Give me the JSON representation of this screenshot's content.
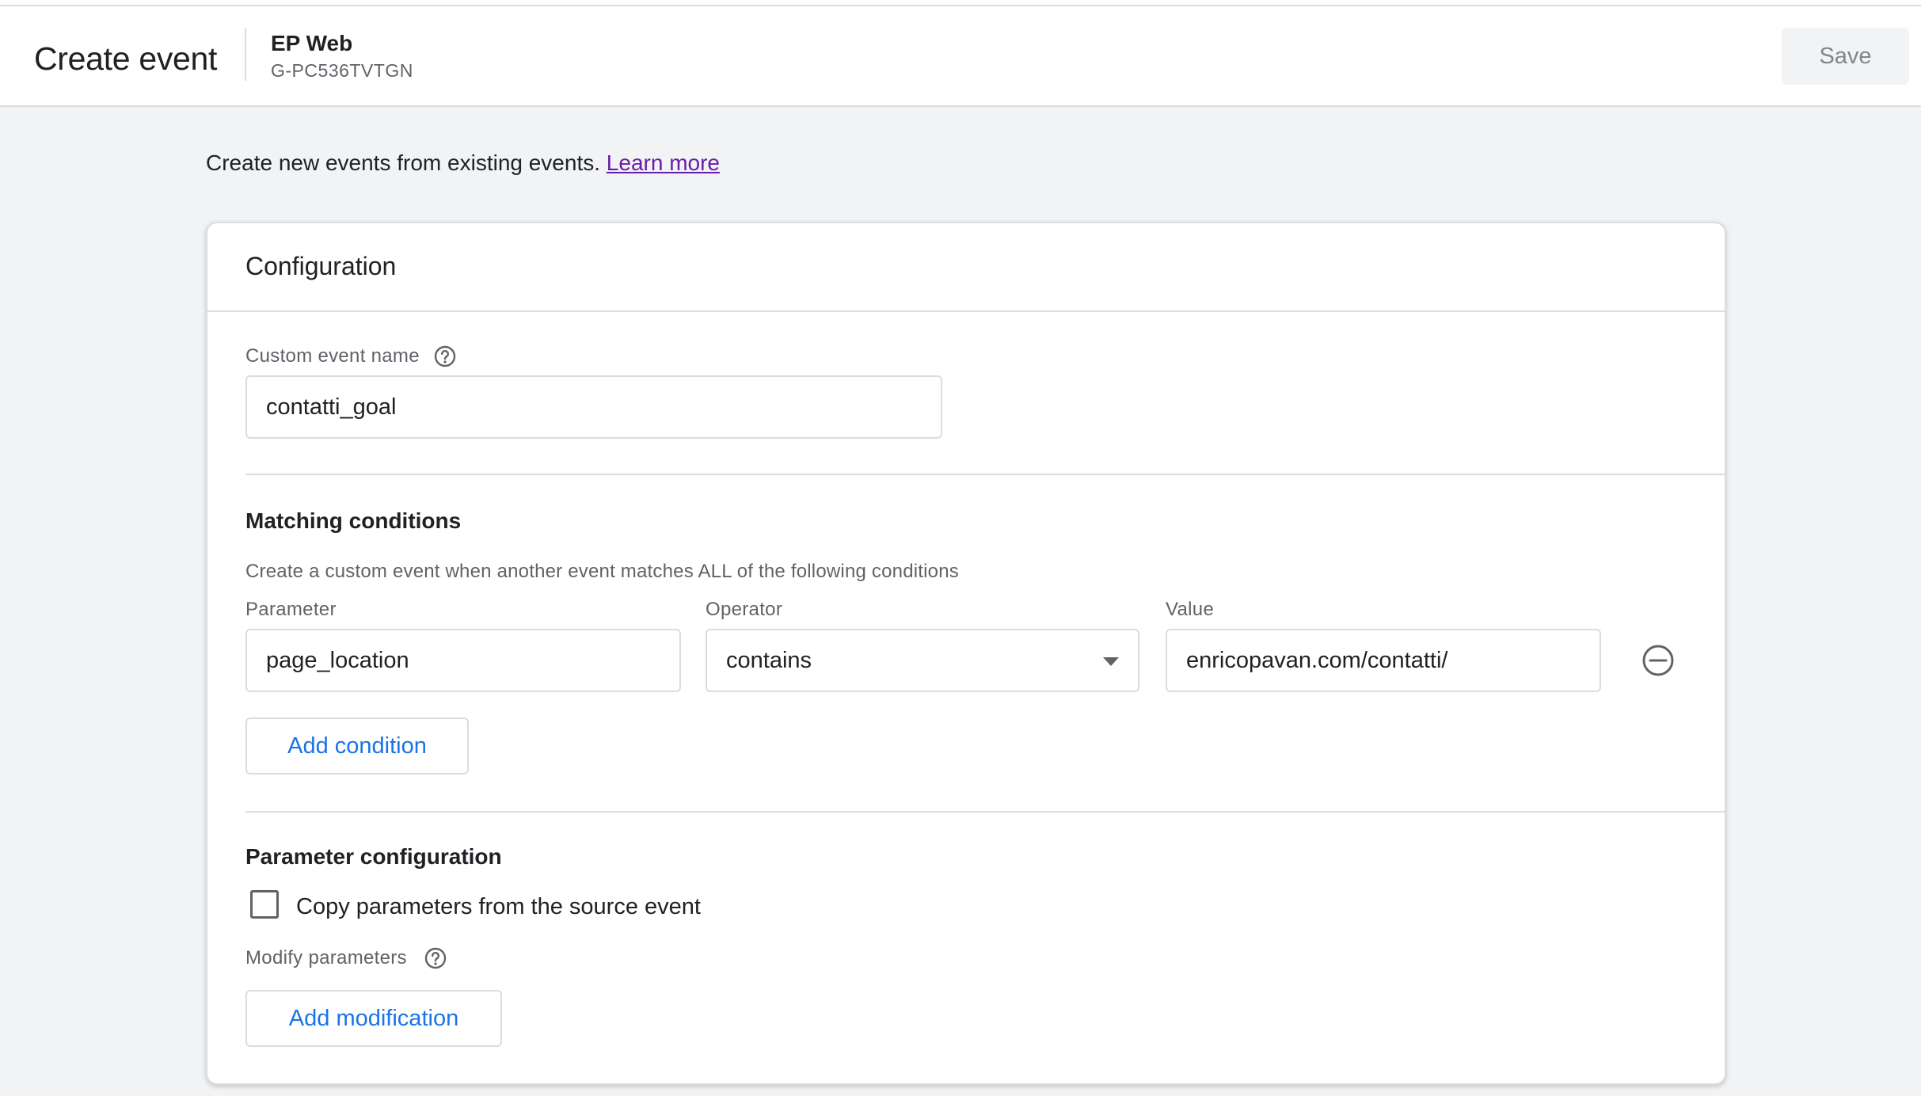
{
  "header": {
    "title": "Create event",
    "property_name": "EP Web",
    "property_id": "G-PC536TVTGN",
    "save_label": "Save"
  },
  "intro": {
    "text": "Create new events from existing events.",
    "link": "Learn more"
  },
  "card": {
    "title": "Configuration",
    "custom_event_name": {
      "label": "Custom event name",
      "value": "contatti_goal"
    },
    "matching": {
      "title": "Matching conditions",
      "description": "Create a custom event when another event matches ALL of the following conditions",
      "parameter_label": "Parameter",
      "operator_label": "Operator",
      "value_label": "Value",
      "conditions": [
        {
          "parameter": "page_location",
          "operator": "contains",
          "value": "enricopavan.com/contatti/"
        }
      ],
      "add_condition_label": "Add condition"
    },
    "param_config": {
      "title": "Parameter configuration",
      "copy_label": "Copy parameters from the source event",
      "copy_checked": false,
      "modify_label": "Modify parameters",
      "add_modification_label": "Add modification"
    }
  },
  "icons": {
    "help": "help-circle-icon",
    "remove": "remove-circle-icon",
    "dropdown": "dropdown-caret-icon"
  },
  "colors": {
    "link": "#681da8",
    "accent": "#1a73e8",
    "background": "#f1f3f4"
  }
}
